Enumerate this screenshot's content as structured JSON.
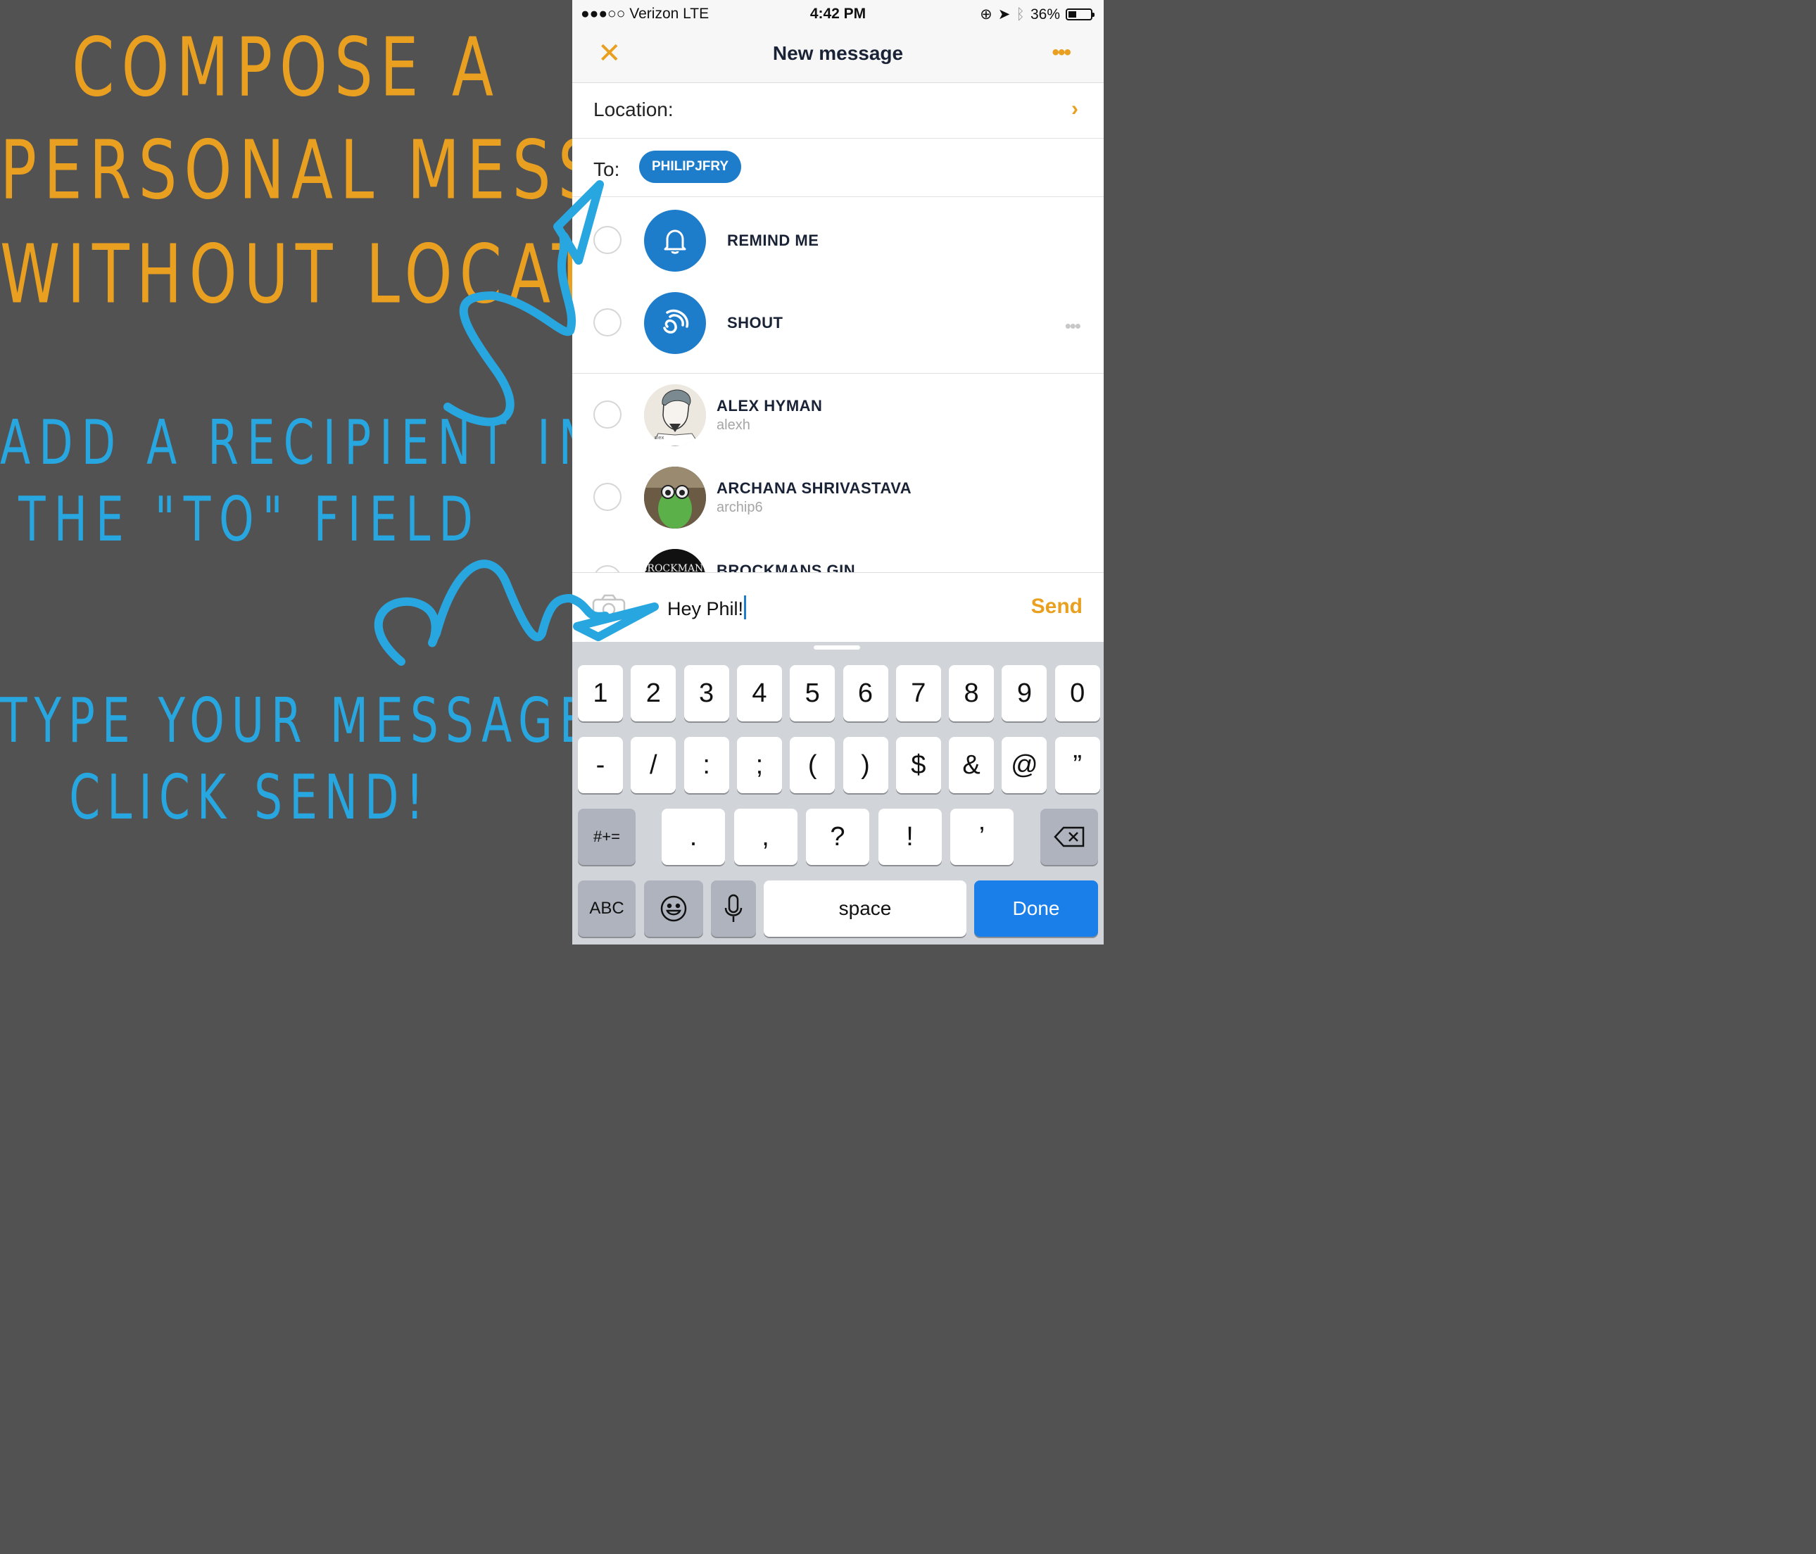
{
  "annotations": {
    "title_lines": [
      "Compose a",
      "personal message",
      "without location"
    ],
    "step1_lines": [
      "Add a recipient in",
      "the \"to\" field"
    ],
    "step2_lines": [
      "Type your message &",
      "click send!"
    ],
    "title_color": "#E9A020",
    "step_color": "#27A6E0"
  },
  "status_bar": {
    "carrier": "●●●○○ Verizon   LTE",
    "time": "4:42 PM",
    "battery": "36%"
  },
  "nav": {
    "close_icon": "close-x-icon",
    "title": "New message",
    "more_icon": "more-dots-icon"
  },
  "location": {
    "label": "Location:"
  },
  "to": {
    "label": "To:",
    "recipient_chip": "PHILIPJFRY"
  },
  "special_options": [
    {
      "label": "REMIND ME",
      "icon": "bell-icon"
    },
    {
      "label": "SHOUT",
      "icon": "shout-icon"
    }
  ],
  "contacts": [
    {
      "name": "ALEX HYMAN",
      "username": "alexh"
    },
    {
      "name": "ARCHANA SHRIVASTAVA",
      "username": "archip6"
    },
    {
      "name": "BROCKMANS GIN",
      "username": "",
      "avatar_text": "BROCKMANS"
    }
  ],
  "composer": {
    "camera_icon": "camera-icon",
    "message": "Hey Phil!",
    "send_label": "Send"
  },
  "keyboard": {
    "row1": [
      "1",
      "2",
      "3",
      "4",
      "5",
      "6",
      "7",
      "8",
      "9",
      "0"
    ],
    "row2": [
      "-",
      "/",
      ":",
      ";",
      "(",
      ")",
      "$",
      "&",
      "@",
      "”"
    ],
    "row3": [
      ".",
      ",",
      "?",
      "!",
      "’"
    ],
    "symbols_key": "#+=",
    "abc_key": "ABC",
    "space_key": "space",
    "done_key": "Done"
  },
  "colors": {
    "accent_orange": "#E9A020",
    "brand_blue": "#1E7DCB",
    "keyboard_done_blue": "#1B7FEA",
    "left_panel_bg": "#525252"
  }
}
